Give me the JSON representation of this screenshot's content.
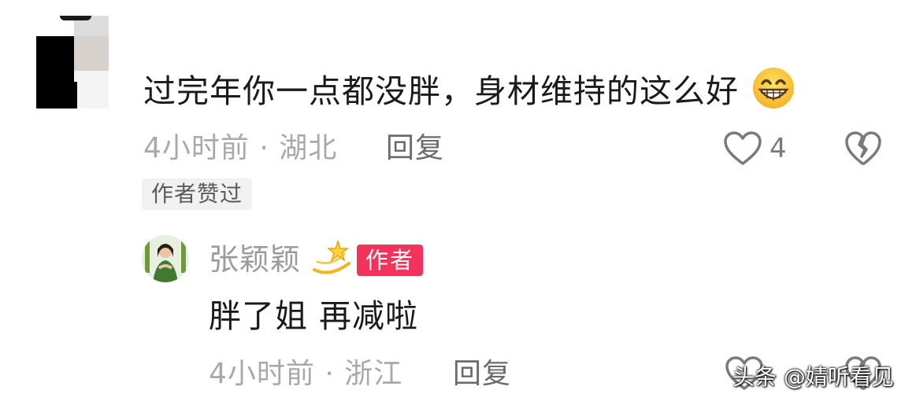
{
  "comment": {
    "text": "过完年你一点都没胖，身材维持的这么好",
    "emoji": "grinning-face",
    "meta": "4小时前 · 湖北",
    "reply_label": "回复",
    "like_count": "4",
    "author_liked_badge": "作者赞过"
  },
  "reply": {
    "author_name": "张颖颖",
    "author_emoji": "dizzy-star",
    "author_badge": "作者",
    "text": "胖了姐 再减啦",
    "meta": "4小时前 · 浙江",
    "reply_label": "回复"
  },
  "watermark": "头条 @婧听看见",
  "colors": {
    "badge_red": "#f2345c",
    "text_primary": "#1a1a1a",
    "text_secondary": "#a9a9a9"
  }
}
